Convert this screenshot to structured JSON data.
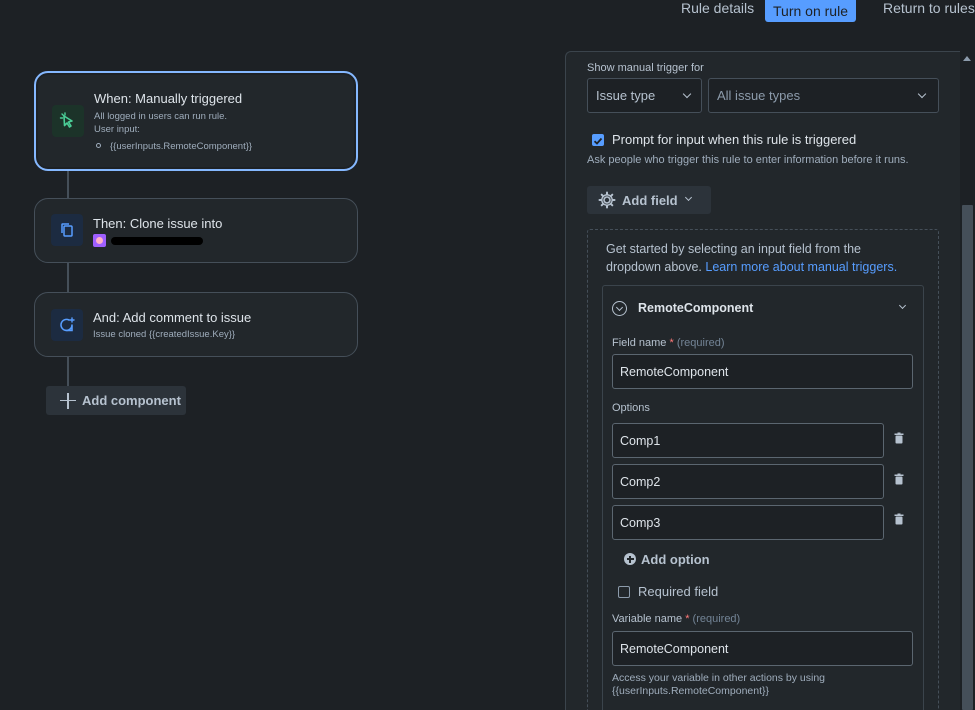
{
  "topbar": {
    "rule_details": "Rule details",
    "turn_on_rule": "Turn on rule",
    "return_to_rules": "Return to rules"
  },
  "flow": {
    "trigger": {
      "title": "When: Manually triggered",
      "line1": "All logged in users can run rule.",
      "line2": "User input:",
      "input_item": "{{userInputs.RemoteComponent}}"
    },
    "clone": {
      "title": "Then: Clone issue into"
    },
    "comment": {
      "title": "And: Add comment to issue",
      "sub": "Issue cloned {{createdIssue.Key}}"
    },
    "add_component": "Add component"
  },
  "panel": {
    "show_trigger_label": "Show manual trigger for",
    "issue_type_select": "Issue type",
    "issue_types_select": "All issue types",
    "prompt_checkbox_label": "Prompt for input when this rule is triggered",
    "prompt_checked": true,
    "prompt_help": "Ask people who trigger this rule to enter information before it runs.",
    "add_field": "Add field",
    "intro_text": "Get started by selecting an input field from the dropdown above.",
    "intro_link": "Learn more about manual triggers.",
    "field_card": {
      "title": "RemoteComponent",
      "field_name_label": "Field name",
      "required_marker": "*",
      "required_hint": "(required)",
      "field_name_value": "RemoteComponent",
      "options_label": "Options",
      "options": [
        "Comp1",
        "Comp2",
        "Comp3"
      ],
      "add_option": "Add option",
      "required_field_label": "Required field",
      "required_field_checked": false,
      "variable_name_label": "Variable name",
      "variable_name_value": "RemoteComponent",
      "variable_help_1": "Access your variable in other actions by using",
      "variable_help_2": "{{userInputs.RemoteComponent}}"
    }
  },
  "colors": {
    "accent": "#579dff",
    "background": "#1d2125",
    "surface": "#22272b",
    "trigger_icon": "#4bce97",
    "link": "#579dff"
  }
}
